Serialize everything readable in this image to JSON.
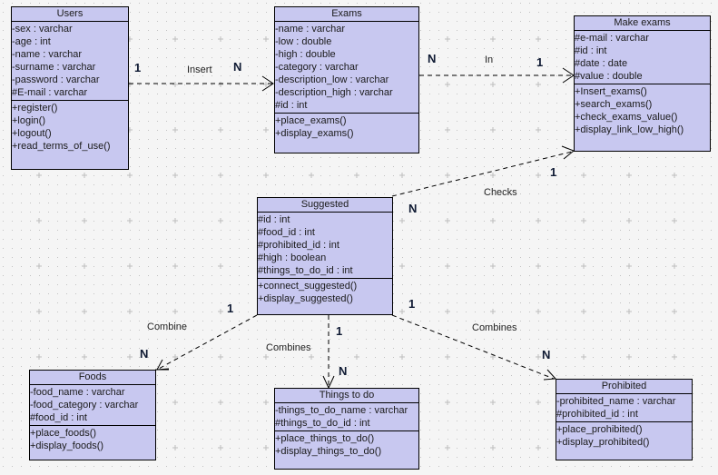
{
  "classes": {
    "users": {
      "name": "Users",
      "attributes": [
        "-sex : varchar",
        "-age : int",
        "-name : varchar",
        "-surname : varchar",
        "-password : varchar",
        "#E-mail : varchar"
      ],
      "operations": [
        "+register()",
        "+login()",
        "+logout()",
        "+read_terms_of_use()"
      ]
    },
    "exams": {
      "name": "Exams",
      "attributes": [
        "-name : varchar",
        "-low : double",
        "-high : double",
        "-category : varchar",
        "-description_low : varchar",
        "-description_high : varchar",
        "#id : int"
      ],
      "operations": [
        "+place_exams()",
        "+display_exams()"
      ]
    },
    "make_exams": {
      "name": "Make exams",
      "attributes": [
        "#e-mail : varchar",
        "#id : int",
        "#date : date",
        "#value : double"
      ],
      "operations": [
        "+Insert_exams()",
        "+search_exams()",
        "+check_exams_value()",
        "+display_link_low_high()"
      ]
    },
    "suggested": {
      "name": "Suggested",
      "attributes": [
        "#id : int",
        "#food_id : int",
        "#prohibited_id : int",
        "#high : boolean",
        "#things_to_do_id : int"
      ],
      "operations": [
        "+connect_suggested()",
        "+display_suggested()"
      ]
    },
    "foods": {
      "name": "Foods",
      "attributes": [
        "-food_name : varchar",
        "-food_category : varchar",
        "#food_id : int"
      ],
      "operations": [
        "+place_foods()",
        "+display_foods()"
      ]
    },
    "things_to_do": {
      "name": "Things to do",
      "attributes": [
        "-things_to_do_name : varchar",
        "#things_to_do_id : int"
      ],
      "operations": [
        "+place_things_to_do()",
        "+display_things_to_do()"
      ]
    },
    "prohibited": {
      "name": "Prohibited",
      "attributes": [
        "-prohibited_name : varchar",
        "#prohibited_id : int"
      ],
      "operations": [
        "+place_prohibited()",
        "+display_prohibited()"
      ]
    }
  },
  "relations": {
    "insert": {
      "label": "Insert",
      "from": "Users",
      "to": "Exams",
      "from_mult": "1",
      "to_mult": "N"
    },
    "in": {
      "label": "In",
      "from": "Exams",
      "to": "Make exams",
      "from_mult": "N",
      "to_mult": "1"
    },
    "checks": {
      "label": "Checks",
      "from": "Suggested",
      "to": "Make exams",
      "from_mult": "N",
      "to_mult": "1"
    },
    "combine_foods": {
      "label": "Combine",
      "from": "Suggested",
      "to": "Foods",
      "from_mult": "1",
      "to_mult": "N"
    },
    "combines_things": {
      "label": "Combines",
      "from": "Suggested",
      "to": "Things to do",
      "from_mult": "1",
      "to_mult": "N"
    },
    "combines_prohibited": {
      "label": "Combines",
      "from": "Suggested",
      "to": "Prohibited",
      "from_mult": "1",
      "to_mult": "N"
    }
  }
}
